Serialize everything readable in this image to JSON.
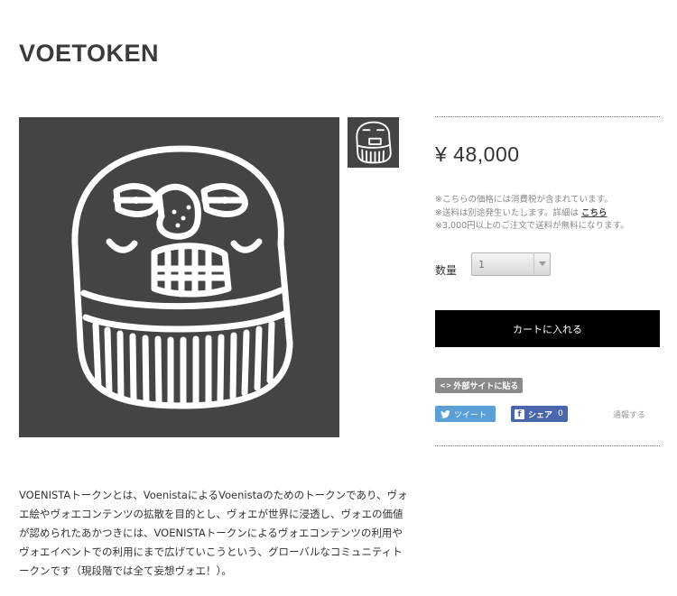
{
  "product": {
    "title": "VOETOKEN",
    "price": "¥ 48,000",
    "notes": {
      "line1": "※こちらの価格には消費税が含まれています。",
      "line2_prefix": "※送料は別途発生いたします。詳細は",
      "line2_link": "こちら",
      "line3": "※3,000円以上のご注文で送料が無料になります。"
    },
    "quantity": {
      "label": "数量",
      "value": "1"
    },
    "cart_button": "カートに入れる",
    "embed_button": {
      "icon": "<>",
      "label": "外部サイトに貼る"
    },
    "tweet_button": "ツイート",
    "share_button": {
      "label": "シェア",
      "count": "0"
    },
    "report_link": "通報する",
    "description": "VOENISTAトークンとは、VoenistaによるVoenistaのためのトークンであり、ヴォエ絵やヴォエコンテンツの拡散を目的とし、ヴォエが世界に浸透し、ヴォエの価値が認められたあかつきには、VOENISTAトークンによるヴォエコンテンツの利用やヴォエイベントでの利用にまで広げていこうという、グローバルなコミュニティトークンです（現段階では全て妄想ヴォエ！）。"
  },
  "colors": {
    "image_bg": "#444444",
    "cart_bg": "#000000",
    "tweet_bg": "#5b9fd9",
    "share_bg": "#4a67ad",
    "embed_bg": "#8a8a8a"
  }
}
